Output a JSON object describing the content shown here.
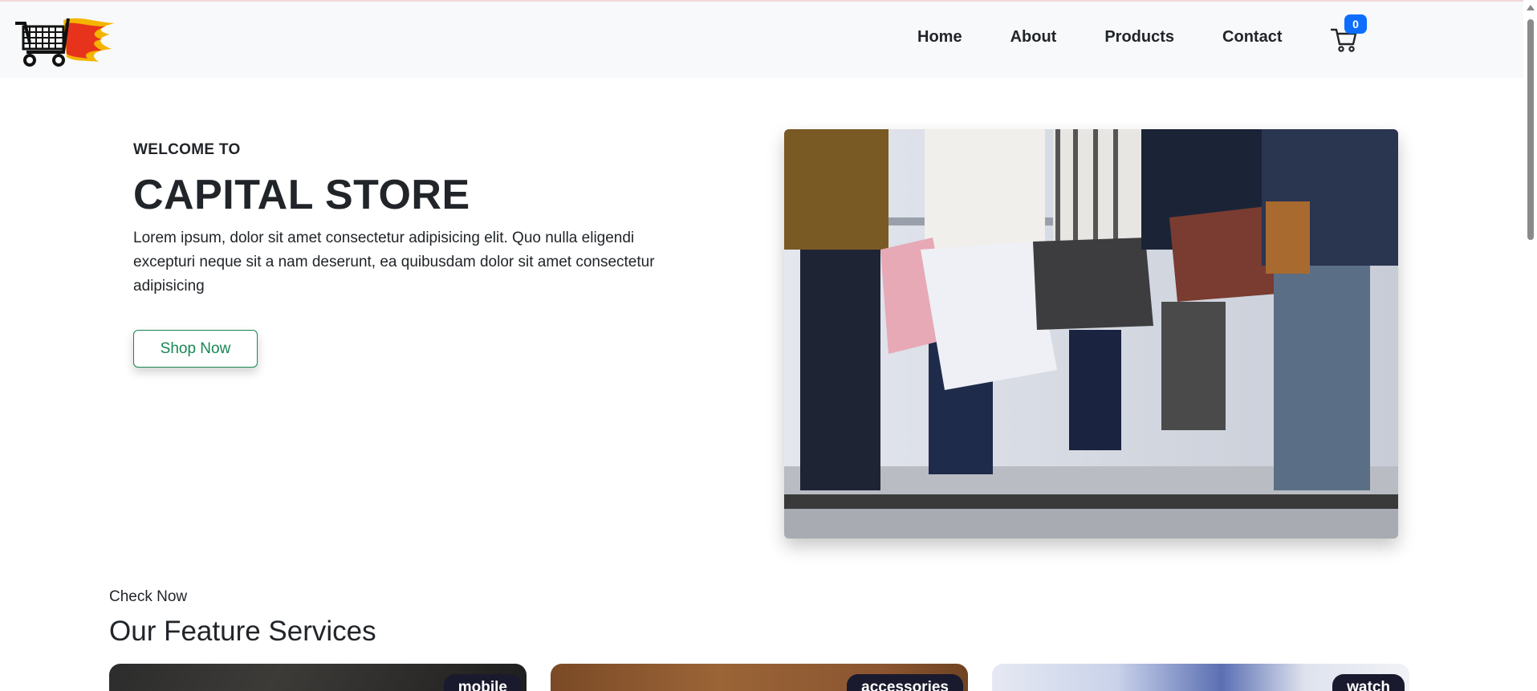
{
  "nav": {
    "logo_icon": "flaming-shopping-cart-logo",
    "links": [
      "Home",
      "About",
      "Products",
      "Contact"
    ],
    "cart_icon": "shopping-cart-icon",
    "cart_count": "0"
  },
  "hero": {
    "kicker": "WELCOME TO",
    "title": "CAPITAL STORE",
    "text": "Lorem ipsum, dolor sit amet consectetur adipisicing elit. Quo nulla eligendi excepturi neque sit a nam deserunt, ea quibusdam dolor sit amet consectetur adipisicing",
    "button_label": "Shop Now",
    "image": "people-holding-shopping-bags-photo"
  },
  "features": {
    "kicker": "Check Now",
    "title": "Our Feature Services",
    "cards": [
      {
        "tag": "mobile"
      },
      {
        "tag": "accessories"
      },
      {
        "tag": "watch"
      }
    ]
  },
  "colors": {
    "navbar_bg": "#f8f9fa",
    "accent_green": "#198754",
    "badge_blue": "#0d6efd",
    "tag_dark": "#1a1a2e"
  }
}
